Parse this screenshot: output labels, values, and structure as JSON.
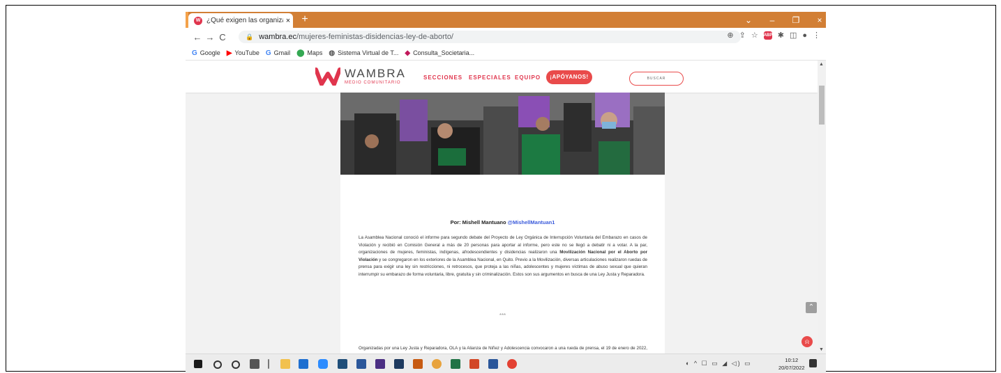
{
  "browser": {
    "tab_title": "¿Qué exigen las organizaciones c",
    "tab_close": "×",
    "new_tab": "+",
    "url_host": "wambra.ec",
    "url_path": "/mujeres-feministas-disidencias-ley-de-aborto/",
    "window_controls": [
      "⌄",
      "–",
      "❐",
      "×"
    ],
    "bookmarks": [
      {
        "label": "Google",
        "icon": "google-icon",
        "glyph": "G",
        "color": "#4285f4"
      },
      {
        "label": "YouTube",
        "icon": "youtube-icon",
        "glyph": "▶",
        "color": "#ff0000"
      },
      {
        "label": "Gmail",
        "icon": "gmail-icon",
        "glyph": "G",
        "color": "#4285f4"
      },
      {
        "label": "Maps",
        "icon": "maps-icon",
        "glyph": "⬤",
        "color": "#34a853"
      },
      {
        "label": "Sistema Virtual de T...",
        "icon": "globe-icon",
        "glyph": "◍",
        "color": "#555555"
      },
      {
        "label": "Consulta_Societaria...",
        "icon": "diamond-icon",
        "glyph": "◆",
        "color": "#c2185b"
      }
    ]
  },
  "site": {
    "brand": "WAMBRA",
    "brand_sub": "MEDIO COMUNITARIO",
    "nav": [
      "SECCIONES",
      "ESPECIALES",
      "EQUIPO"
    ],
    "cta": "¡APÓYANOS!",
    "search": "BUSCAR",
    "accent": "#e0354d"
  },
  "article": {
    "byline_prefix": "Por: Mishell Mantuano ",
    "byline_handle": "@MishellMantuan1",
    "p1_a": "La Asamblea Nacional conoció el informe para segundo debate del Proyecto de Ley Orgánica de Interrupción Voluntaria del Embarazo en casos de Violación y recibió en Comisión General a más de 20 personas para aportar al informe, pero este no se llegó a debatir ni a votar.  A la par, organizaciones de mujeres, feministas, indígenas, afrodescendientes y disidencias realizaron una ",
    "p1_bold": "Movilización Nacional por el Aborto por Violación",
    "p1_b": " y se congregaron en los exteriores de la Asamblea Nacional, en Quito. Previo a la Movilización, diversas articulaciones realizaron ruedas de prensa para exigir una ley sin restricciones, ni retrocesos, que proteja a las niñas, adolescentes y mujeres víctimas de abuso sexual que quieran interrumpir su embarazo de forma voluntaria, libre, gratuita y sin criminalización. Estos son sus argumentos en busca de una Ley Justa y Reparadora.",
    "separator": "***",
    "p2": "Organizadas por una Ley Justa y Reparadora, OLA y la Alianza de Niñez y Adolescencia convocaron a una rueda de prensa, el 19 de enero de 2022, para dar a conocer sus argumentos alrededor de proyecto de Ley Orgánica de Interrupción Voluntaria del"
  },
  "taskbar": {
    "time": "10:12",
    "date": "20/07/2022"
  }
}
